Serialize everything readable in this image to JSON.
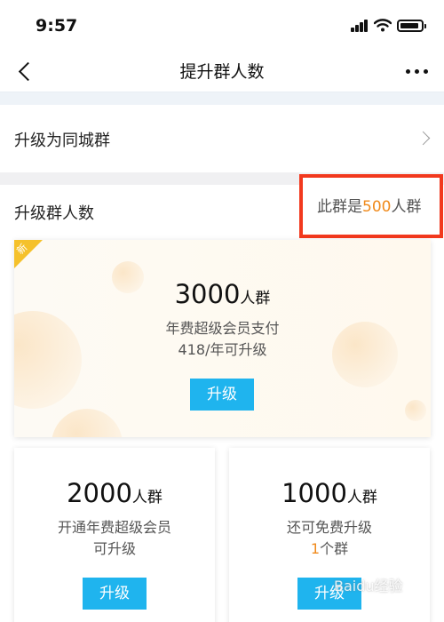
{
  "status_bar": {
    "time": "9:57"
  },
  "nav": {
    "title": "提升群人数"
  },
  "city_row": {
    "label": "升级为同城群"
  },
  "section": {
    "title": "升级群人数",
    "current_prefix": "此群是",
    "current_number": "500",
    "current_suffix": "人群"
  },
  "cards": [
    {
      "badge": "新",
      "amount": "3000",
      "unit": "人群",
      "line1": "年费超级会员支付",
      "line2": "418/年可升级",
      "button": "升级"
    },
    {
      "amount": "2000",
      "unit": "人群",
      "line1": "开通年费超级会员",
      "line2": "可升级",
      "button": "升级"
    },
    {
      "amount": "1000",
      "unit": "人群",
      "line1": "还可免费升级",
      "line2_number": "1",
      "line2_suffix": "个群",
      "button": "升级"
    }
  ],
  "watermark": "Baidu经验",
  "colors": {
    "accent_blue": "#1fb4ee",
    "highlight_orange": "#f08a1c",
    "annotation_red": "#f2391e",
    "badge_yellow": "#f5c12b"
  }
}
